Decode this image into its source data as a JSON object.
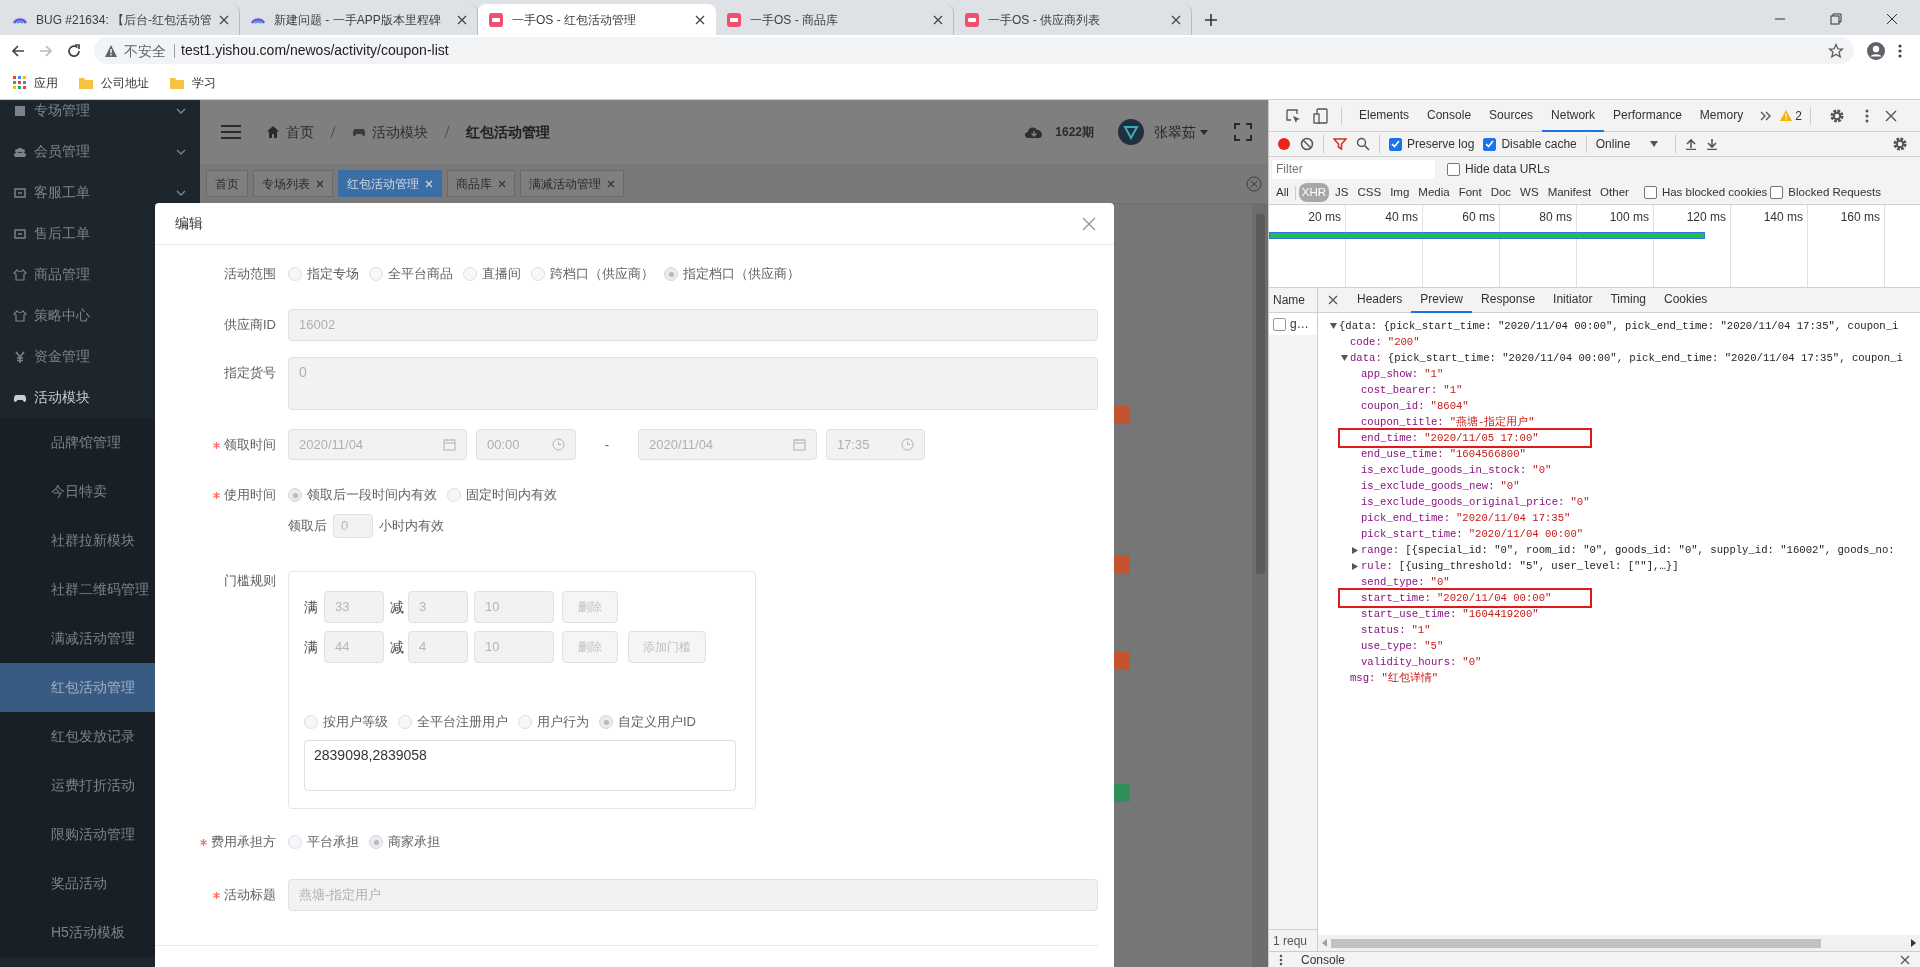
{
  "browser": {
    "tabs": [
      {
        "title": "BUG #21634: 【后台-红包活动管",
        "kind": "arc",
        "selected": false
      },
      {
        "title": "新建问题 - 一手APP版本里程碑",
        "kind": "arc",
        "selected": false
      },
      {
        "title": "一手OS - 红包活动管理",
        "kind": "app",
        "selected": true
      },
      {
        "title": "一手OS - 商品库",
        "kind": "app",
        "selected": false
      },
      {
        "title": "一手OS - 供应商列表",
        "kind": "app",
        "selected": false
      }
    ],
    "security": "不安全",
    "url": "test1.yishou.com/newos/activity/coupon-list",
    "bookmarks": [
      {
        "label": "应用",
        "kind": "apps"
      },
      {
        "label": "公司地址",
        "kind": "folder"
      },
      {
        "label": "学习",
        "kind": "folder"
      }
    ]
  },
  "app": {
    "sidebar": [
      {
        "label": "专场管理",
        "expanded": false
      },
      {
        "label": "会员管理",
        "expanded": false
      },
      {
        "label": "客服工单",
        "expanded": false
      },
      {
        "label": "售后工单"
      },
      {
        "label": "商品管理"
      },
      {
        "label": "策略中心"
      },
      {
        "label": "资金管理"
      },
      {
        "label": "活动模块",
        "expanded": true,
        "children": [
          {
            "label": "品牌馆管理",
            "selected": false
          },
          {
            "label": "今日特卖",
            "selected": false
          },
          {
            "label": "社群拉新模块",
            "selected": false
          },
          {
            "label": "社群二维码管理",
            "selected": false
          },
          {
            "label": "满减活动管理",
            "selected": false
          },
          {
            "label": "红包活动管理",
            "selected": true
          },
          {
            "label": "红包发放记录",
            "selected": false
          },
          {
            "label": "运费打折活动",
            "selected": false
          },
          {
            "label": "限购活动管理",
            "selected": false
          },
          {
            "label": "奖品活动",
            "selected": false
          },
          {
            "label": "H5活动模板",
            "selected": false
          }
        ]
      }
    ],
    "header": {
      "breadcrumb": [
        "首页",
        "活动模块",
        "红包活动管理"
      ],
      "period": "1622期",
      "user": "张翠茹"
    },
    "tags": [
      {
        "label": "首页",
        "closable": false,
        "selected": false
      },
      {
        "label": "专场列表",
        "closable": true,
        "selected": false
      },
      {
        "label": "红包活动管理",
        "closable": true,
        "selected": true
      },
      {
        "label": "商品库",
        "closable": true,
        "selected": false
      },
      {
        "label": "满减活动管理",
        "closable": true,
        "selected": false
      }
    ],
    "background_tags": [
      {
        "color": "#c4532f"
      },
      {
        "color": "#c4532f"
      },
      {
        "color": "#c4532f"
      },
      {
        "color": "#2f8f5b"
      }
    ]
  },
  "modal": {
    "title": "编辑",
    "fields": [
      {
        "kind": "radio",
        "label": "活动范围",
        "required": false,
        "options": [
          {
            "label": "指定专场",
            "selected": false
          },
          {
            "label": "全平台商品",
            "selected": false
          },
          {
            "label": "直播间",
            "selected": false
          },
          {
            "label": "跨档口（供应商）",
            "selected": false
          },
          {
            "label": "指定档口（供应商）",
            "selected": true
          }
        ]
      },
      {
        "kind": "input",
        "label": "供应商ID",
        "required": false,
        "value": "16002"
      },
      {
        "kind": "textarea",
        "label": "指定货号",
        "required": false,
        "value": "0"
      },
      {
        "kind": "range",
        "label": "领取时间",
        "required": true,
        "start_date": "2020/11/04",
        "start_time": "00:00",
        "separator": "-",
        "end_date": "2020/11/04",
        "end_time": "17:35"
      },
      {
        "kind": "radio",
        "label": "使用时间",
        "required": true,
        "options": [
          {
            "label": "领取后一段时间内有效",
            "selected": true
          },
          {
            "label": "固定时间内有效",
            "selected": false
          }
        ],
        "sub": {
          "prefix": "领取后",
          "value": "0",
          "suffix": "小时内有效"
        }
      },
      {
        "kind": "threshold",
        "label": "门槛规则",
        "required": false,
        "rules": [
          {
            "full_label": "满",
            "full": "33",
            "minus_label": "减",
            "minus": "3",
            "limit": "10",
            "delete": "删除"
          },
          {
            "full_label": "满",
            "full": "44",
            "minus_label": "减",
            "minus": "4",
            "limit": "10",
            "delete": "删除"
          }
        ],
        "add": "添加门槛",
        "audience": [
          {
            "label": "按用户等级",
            "selected": false
          },
          {
            "label": "全平台注册用户",
            "selected": false
          },
          {
            "label": "用户行为",
            "selected": false
          },
          {
            "label": "自定义用户ID",
            "selected": true
          }
        ],
        "user_ids": "2839098,2839058"
      },
      {
        "kind": "radio",
        "label": "费用承担方",
        "required": true,
        "options": [
          {
            "label": "平台承担",
            "selected": false
          },
          {
            "label": "商家承担",
            "selected": true
          }
        ]
      },
      {
        "kind": "input",
        "label": "活动标题",
        "required": true,
        "value": "燕塘-指定用户"
      }
    ]
  },
  "devtools": {
    "tabs": [
      {
        "label": "Elements",
        "selected": false
      },
      {
        "label": "Console",
        "selected": false
      },
      {
        "label": "Sources",
        "selected": false
      },
      {
        "label": "Network",
        "selected": true
      },
      {
        "label": "Performance",
        "selected": false
      },
      {
        "label": "Memory",
        "selected": false
      }
    ],
    "warnings": "2",
    "preserve_log": {
      "label": "Preserve log",
      "checked": true
    },
    "disable_cache": {
      "label": "Disable cache",
      "checked": true
    },
    "throttle": "Online",
    "filter_placeholder": "Filter",
    "hide_data_urls": {
      "label": "Hide data URLs",
      "checked": false
    },
    "types": [
      {
        "label": "All",
        "selected": false
      },
      {
        "label": "XHR",
        "selected": true
      },
      {
        "label": "JS",
        "selected": false
      },
      {
        "label": "CSS",
        "selected": false
      },
      {
        "label": "Img",
        "selected": false
      },
      {
        "label": "Media",
        "selected": false
      },
      {
        "label": "Font",
        "selected": false
      },
      {
        "label": "Doc",
        "selected": false
      },
      {
        "label": "WS",
        "selected": false
      },
      {
        "label": "Manifest",
        "selected": false
      },
      {
        "label": "Other",
        "selected": false
      }
    ],
    "blocked_cookies": {
      "label": "Has blocked cookies",
      "checked": false
    },
    "blocked_requests": {
      "label": "Blocked Requests",
      "checked": false
    },
    "timeline": {
      "ticks": [
        "20 ms",
        "40 ms",
        "60 ms",
        "80 ms",
        "100 ms",
        "120 ms",
        "140 ms",
        "160 ms"
      ],
      "level": 0.67
    },
    "name_header": "Name",
    "requests": [
      {
        "name": "g…",
        "checked": false
      }
    ],
    "request_count": "1 requ",
    "detail_tabs": [
      {
        "label": "Headers",
        "selected": false
      },
      {
        "label": "Preview",
        "selected": true
      },
      {
        "label": "Response",
        "selected": false
      },
      {
        "label": "Initiator",
        "selected": false
      },
      {
        "label": "Timing",
        "selected": false
      },
      {
        "label": "Cookies",
        "selected": false
      }
    ],
    "preview": [
      {
        "text": "{data: {pick_start_time: \"2020/11/04 00:00\", pick_end_time: \"2020/11/04 17:35\", coupon_i",
        "expanded": true,
        "boxed": false,
        "children": [
          {
            "key": "code:",
            "value": "\"200\"",
            "boxed": false
          },
          {
            "key": "data:",
            "value": "{pick_start_time: \"2020/11/04 00:00\", pick_end_time: \"2020/11/04 17:35\", coupon_i",
            "expanded": true,
            "boxed": false,
            "children": [
              {
                "key": "app_show:",
                "value": "\"1\"",
                "boxed": false
              },
              {
                "key": "cost_bearer:",
                "value": "\"1\"",
                "boxed": false
              },
              {
                "key": "coupon_id:",
                "value": "\"8604\"",
                "boxed": false
              },
              {
                "key": "coupon_title:",
                "value": "\"燕塘-指定用户\"",
                "boxed": false
              },
              {
                "key": "end_time:",
                "value": "\"2020/11/05 17:00\"",
                "boxed": true
              },
              {
                "key": "end_use_time:",
                "value": "\"1604566800\"",
                "boxed": false
              },
              {
                "key": "is_exclude_goods_in_stock:",
                "value": "\"0\"",
                "boxed": false
              },
              {
                "key": "is_exclude_goods_new:",
                "value": "\"0\"",
                "boxed": false
              },
              {
                "key": "is_exclude_goods_original_price:",
                "value": "\"0\"",
                "boxed": false
              },
              {
                "key": "pick_end_time:",
                "value": "\"2020/11/04 17:35\"",
                "boxed": false
              },
              {
                "key": "pick_start_time:",
                "value": "\"2020/11/04 00:00\"",
                "boxed": false
              },
              {
                "key": "range:",
                "value": "[{special_id: \"0\", room_id: \"0\", goods_id: \"0\", supply_id: \"16002\", goods_no:",
                "expanded": false,
                "boxed": false
              },
              {
                "key": "rule:",
                "value": "[{using_threshold: \"5\", user_level: [\"\"],…}]",
                "expanded": false,
                "boxed": false
              },
              {
                "key": "send_type:",
                "value": "\"0\"",
                "boxed": false
              },
              {
                "key": "start_time:",
                "value": "\"2020/11/04 00:00\"",
                "boxed": true
              },
              {
                "key": "start_use_time:",
                "value": "\"1604419200\"",
                "boxed": false
              },
              {
                "key": "status:",
                "value": "\"1\"",
                "boxed": false
              },
              {
                "key": "use_type:",
                "value": "\"5\"",
                "boxed": false
              },
              {
                "key": "validity_hours:",
                "value": "\"0\"",
                "boxed": false
              }
            ]
          },
          {
            "key": "msg:",
            "value": "\"红包详情\"",
            "boxed": false
          }
        ]
      }
    ],
    "drawer": "Console"
  }
}
